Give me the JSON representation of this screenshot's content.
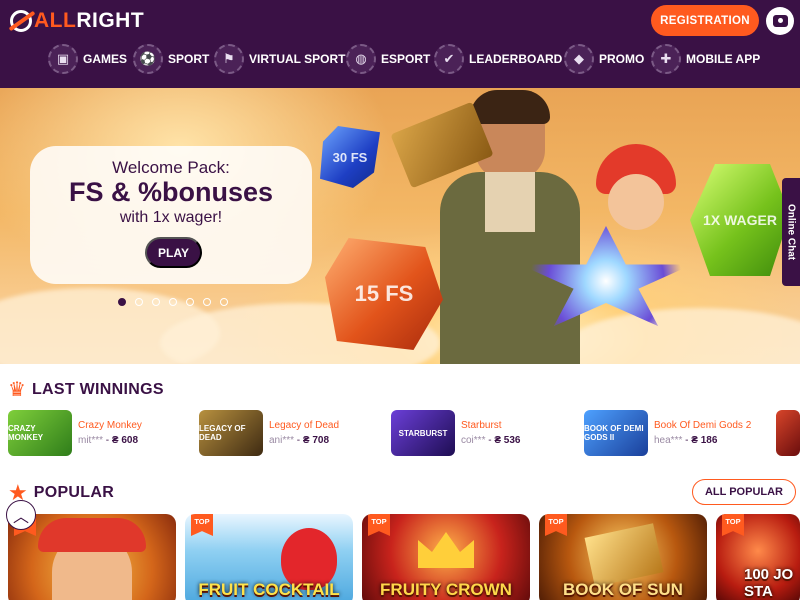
{
  "brand": {
    "logo_text_1": "ALL",
    "logo_text_2": "RIGHT",
    "accent": "#ff5a1f",
    "dark": "#3a1145"
  },
  "header": {
    "registration_label": "REGISTRATION",
    "profile_icon": "profile-chat-icon"
  },
  "nav": {
    "items": [
      {
        "label": "GAMES",
        "icon": "slot-machine-icon"
      },
      {
        "label": "SPORT",
        "icon": "soccer-ball-icon"
      },
      {
        "label": "VIRTUAL SPORT",
        "icon": "running-man-icon"
      },
      {
        "label": "ESPORT",
        "icon": "globe-icon"
      },
      {
        "label": "LEADERBOARD",
        "icon": "check-badge-icon"
      },
      {
        "label": "PROMO",
        "icon": "diamond-icon"
      },
      {
        "label": "MOBILE APP",
        "icon": "gamepad-icon"
      }
    ]
  },
  "hero": {
    "line1": "Welcome Pack:",
    "line2": "FS & %bonuses",
    "line3": "with 1x wager!",
    "play_label": "PLAY",
    "slides_total": 7,
    "active_slide": 1,
    "gem_30fs": "30 FS",
    "gem_15fs": "15 FS",
    "gem_wager": "1X WAGER"
  },
  "online_chat": {
    "label": "Online Chat"
  },
  "last_winnings": {
    "title": "LAST WINNINGS",
    "items": [
      {
        "game": "Crazy Monkey",
        "user": "mit***",
        "amount": "₴ 608",
        "color": "#4ca12f"
      },
      {
        "game": "Legacy of Dead",
        "user": "ani***",
        "amount": "₴ 708",
        "color": "#5b4624"
      },
      {
        "game": "Starburst",
        "user": "coi***",
        "amount": "₴ 536",
        "color": "#3b1c7a"
      },
      {
        "game": "Book Of Demi Gods 2",
        "user": "hea***",
        "amount": "₴ 186",
        "color": "#2d6bc6"
      }
    ]
  },
  "popular": {
    "title": "POPULAR",
    "all_label": "ALL POPULAR",
    "top_badge": "TOP",
    "cards": [
      {
        "title": "",
        "color": "#f3a21f"
      },
      {
        "title": "FRUIT COCKTAIL",
        "color": "#4db4e8"
      },
      {
        "title": "FRUITY CROWN",
        "color": "#c61c1c"
      },
      {
        "title": "BOOK OF SUN",
        "color": "#a35a12"
      },
      {
        "title": "100 JO STA",
        "color": "#c6291e"
      }
    ]
  }
}
